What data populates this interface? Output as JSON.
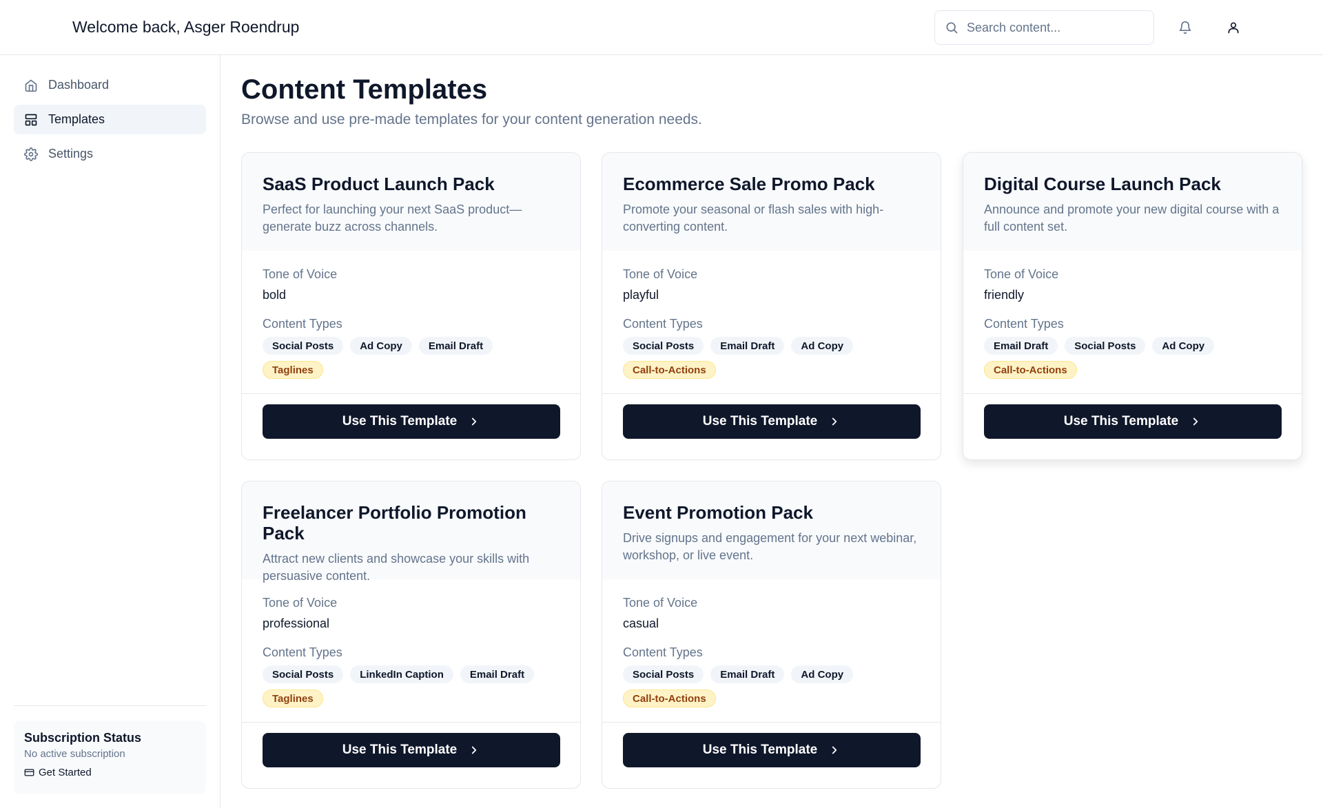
{
  "header": {
    "welcome": "Welcome back, Asger Roendrup",
    "search_placeholder": "Search content...",
    "bell_icon": "bell-icon",
    "user_icon": "user-icon"
  },
  "sidebar": {
    "items": [
      {
        "label": "Dashboard",
        "icon": "home-icon",
        "active": false
      },
      {
        "label": "Templates",
        "icon": "layout-icon",
        "active": true
      },
      {
        "label": "Settings",
        "icon": "gear-icon",
        "active": false
      }
    ],
    "subscription": {
      "title": "Subscription Status",
      "status": "No active subscription",
      "link": "Get Started",
      "link_icon": "credit-card-icon"
    }
  },
  "main": {
    "title": "Content Templates",
    "subtitle": "Browse and use pre-made templates for your content generation needs.",
    "tone_label": "Tone of Voice",
    "types_label": "Content Types",
    "button_label": "Use This Template",
    "templates": [
      {
        "title": "SaaS Product Launch Pack",
        "description": "Perfect for launching your next SaaS product—generate buzz across channels.",
        "tone": "bold",
        "types": [
          {
            "label": "Social Posts",
            "highlight": false
          },
          {
            "label": "Ad Copy",
            "highlight": false
          },
          {
            "label": "Email Draft",
            "highlight": false
          },
          {
            "label": "Taglines",
            "highlight": true
          }
        ]
      },
      {
        "title": "Ecommerce Sale Promo Pack",
        "description": "Promote your seasonal or flash sales with high-converting content.",
        "tone": "playful",
        "types": [
          {
            "label": "Social Posts",
            "highlight": false
          },
          {
            "label": "Email Draft",
            "highlight": false
          },
          {
            "label": "Ad Copy",
            "highlight": false
          },
          {
            "label": "Call-to-Actions",
            "highlight": true
          }
        ]
      },
      {
        "title": "Digital Course Launch Pack",
        "description": "Announce and promote your new digital course with a full content set.",
        "tone": "friendly",
        "types": [
          {
            "label": "Email Draft",
            "highlight": false
          },
          {
            "label": "Social Posts",
            "highlight": false
          },
          {
            "label": "Ad Copy",
            "highlight": false
          },
          {
            "label": "Call-to-Actions",
            "highlight": true
          }
        ]
      },
      {
        "title": "Freelancer Portfolio Promotion Pack",
        "description": "Attract new clients and showcase your skills with persuasive content.",
        "tone": "professional",
        "types": [
          {
            "label": "Social Posts",
            "highlight": false
          },
          {
            "label": "LinkedIn Caption",
            "highlight": false
          },
          {
            "label": "Email Draft",
            "highlight": false
          },
          {
            "label": "Taglines",
            "highlight": true
          }
        ]
      },
      {
        "title": "Event Promotion Pack",
        "description": "Drive signups and engagement for your next webinar, workshop, or live event.",
        "tone": "casual",
        "types": [
          {
            "label": "Social Posts",
            "highlight": false
          },
          {
            "label": "Email Draft",
            "highlight": false
          },
          {
            "label": "Ad Copy",
            "highlight": false
          },
          {
            "label": "Call-to-Actions",
            "highlight": true
          }
        ]
      }
    ]
  },
  "colors": {
    "primary": "#0f172a",
    "muted_text": "#64748b",
    "highlight_tag_bg": "#fef3c7",
    "highlight_tag_text": "#92400e"
  }
}
